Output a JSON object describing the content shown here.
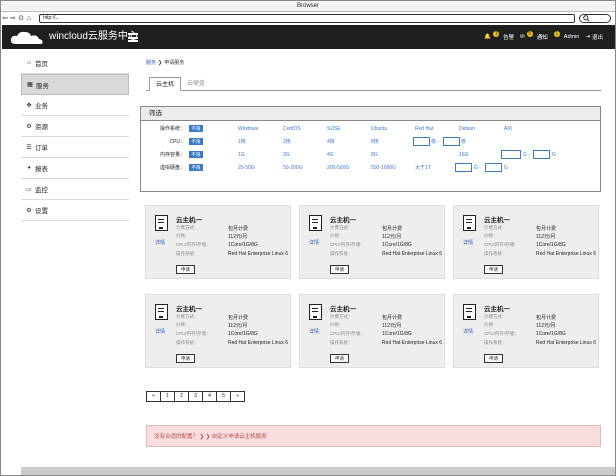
{
  "window": {
    "title": "Browser"
  },
  "nav": {
    "back": "⇦",
    "forward": "⇨",
    "reload": "⊙",
    "home": "⌂",
    "url": "http://...",
    "search_icon": "search-icon"
  },
  "header": {
    "brand": "wincloud云服务中心",
    "bell_badge": "1",
    "bell_label": "告警",
    "mail_badge": "5",
    "mail_label": "通知",
    "user_badge": "1",
    "user_label": "Admin",
    "logout_label": "退出"
  },
  "sidebar": {
    "items": [
      {
        "label": "首页",
        "icon": "home-icon",
        "glyph": "⌂"
      },
      {
        "label": "服务",
        "icon": "grid-icon",
        "glyph": "▦",
        "active": true
      },
      {
        "label": "业务",
        "icon": "arrows-icon",
        "glyph": "✥"
      },
      {
        "label": "资源",
        "icon": "gear-icon",
        "glyph": "⚙"
      },
      {
        "label": "订单",
        "icon": "list-icon",
        "glyph": "☰"
      },
      {
        "label": "报表",
        "icon": "pie-icon",
        "glyph": "◕"
      },
      {
        "label": "监控",
        "icon": "monitor-icon",
        "glyph": "▭"
      },
      {
        "label": "设置",
        "icon": "settings-icon",
        "glyph": "⚙"
      }
    ]
  },
  "breadcrumb": {
    "root": "服务",
    "sep": "❯",
    "current": "申请服务"
  },
  "tabs": [
    {
      "label": "云主机"
    },
    {
      "label": "云硬盘"
    }
  ],
  "filter": {
    "title": "筛选",
    "all_label": "不限",
    "rows": [
      {
        "label": "操作系统：",
        "options": [
          "Windows",
          "CentOS",
          "SUSE",
          "Ubuntu",
          "Red Hat",
          "Debian",
          "AIX"
        ]
      },
      {
        "label": "CPU：",
        "options": [
          "1核",
          "2核",
          "4核",
          "8核"
        ],
        "range_mid": "核 -",
        "range_end": "核"
      },
      {
        "label": "内存容量：",
        "options": [
          "1G",
          "2G",
          "4G",
          "8G",
          "16G"
        ],
        "range_mid": "G -",
        "range_end": "G"
      },
      {
        "label": "虚拟硬盘：",
        "options": [
          "20-50G",
          "50-200G",
          "200-500G",
          "500-1000G",
          "大于1T"
        ],
        "range_mid": "G -",
        "range_end": "G"
      }
    ]
  },
  "card_template": {
    "title": "云主机一",
    "detail": "详情",
    "billing_label": "计费方式：",
    "billing_value": "包月计费",
    "price_label": "价格：",
    "price_value": "112元/月",
    "spec_label": "CPU/内存/存储：",
    "spec_value": "1Core/1G/8G",
    "os_label": "操作系统：",
    "os_value": "Red Hat Enterprise Linux 6",
    "apply": "申请"
  },
  "cards": [
    {},
    {},
    {},
    {},
    {},
    {}
  ],
  "pagination": [
    "«",
    "1",
    "2",
    "3",
    "4",
    "5",
    "»"
  ],
  "alert": {
    "text": "没有合适的配置？ ❯ ❯ 自定义申请云主机服务"
  },
  "colors": {
    "header_bg": "#1f1f1f",
    "link": "#3a7bc8",
    "badge": "#f0c419",
    "alert_bg": "#f8dede"
  }
}
